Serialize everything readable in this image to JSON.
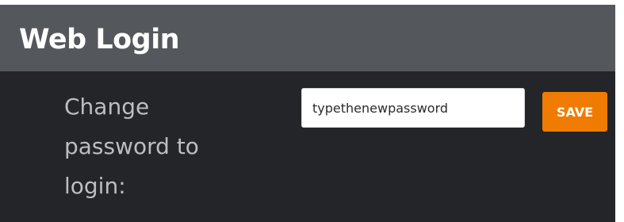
{
  "header": {
    "title": "Web Login"
  },
  "form": {
    "label": "Change\npassword to\nlogin:",
    "password_value": "typethenewpassword",
    "save_label": "SAVE"
  },
  "colors": {
    "header_bg": "#54575c",
    "panel_bg": "#232528",
    "label_text": "#bcbec2",
    "accent": "#ef7c00"
  }
}
